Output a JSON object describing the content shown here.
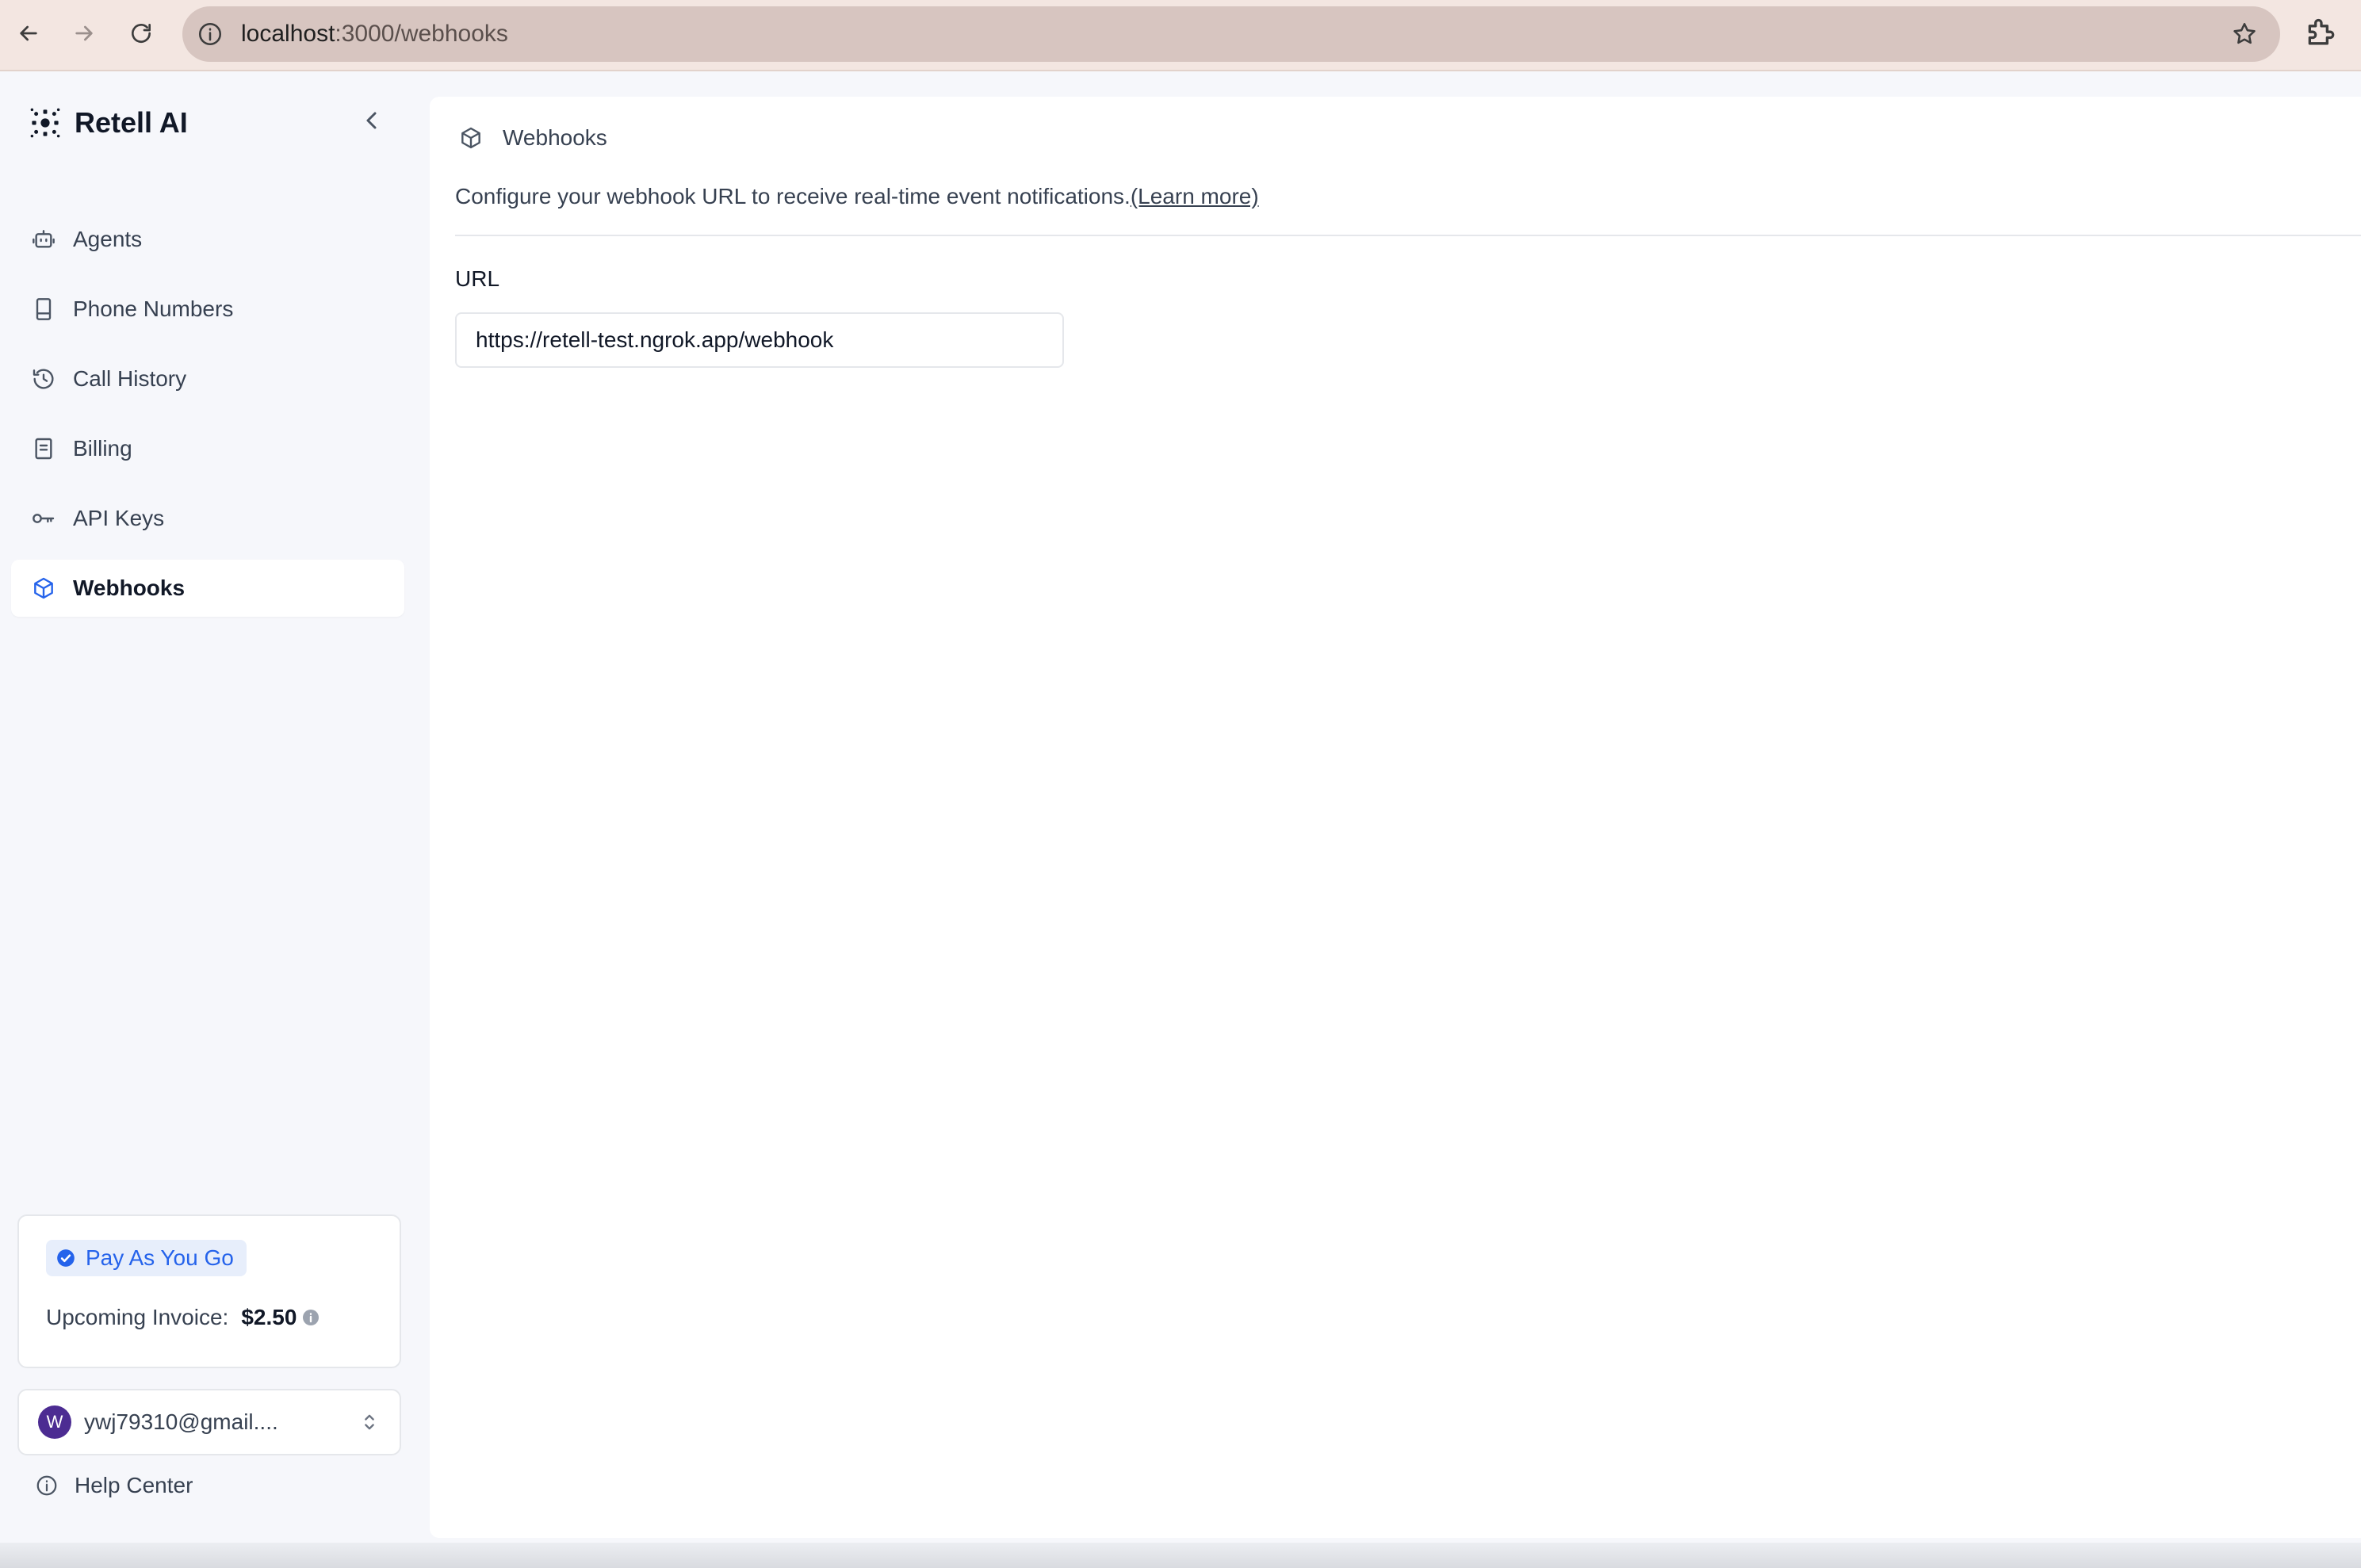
{
  "browser": {
    "url_host": "localhost",
    "url_path": ":3000/webhooks"
  },
  "sidebar": {
    "brand": "Retell AI",
    "items": [
      {
        "label": "Agents",
        "icon": "robot-icon"
      },
      {
        "label": "Phone Numbers",
        "icon": "phone-icon"
      },
      {
        "label": "Call History",
        "icon": "history-icon"
      },
      {
        "label": "Billing",
        "icon": "receipt-icon"
      },
      {
        "label": "API Keys",
        "icon": "key-icon"
      },
      {
        "label": "Webhooks",
        "icon": "webhook-cube-icon",
        "active": true
      }
    ],
    "plan": {
      "badge": "Pay As You Go",
      "invoice_label": "Upcoming Invoice:",
      "invoice_value": "$2.50"
    },
    "account": {
      "avatar_letter": "W",
      "email": "ywj79310@gmail...."
    },
    "help": "Help Center"
  },
  "main": {
    "breadcrumb": "Webhooks",
    "description": "Configure your webhook URL to receive real-time event notifications.",
    "learn_more": "(Learn more)",
    "url_label": "URL",
    "url_value": "https://retell-test.ngrok.app/webhook"
  },
  "colors": {
    "accent": "#2563eb",
    "chrome": "#f3e6e1",
    "avatar": "#4c2c92"
  }
}
